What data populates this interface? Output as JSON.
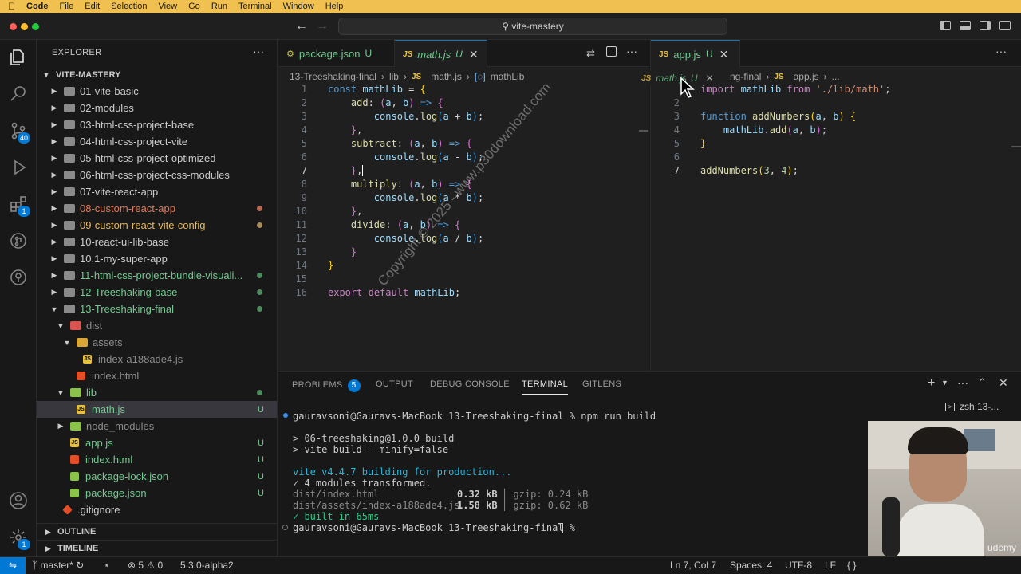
{
  "menubar": {
    "app": "Code",
    "items": [
      "File",
      "Edit",
      "Selection",
      "View",
      "Go",
      "Run",
      "Terminal",
      "Window",
      "Help"
    ]
  },
  "titlebar": {
    "search": "vite-mastery"
  },
  "activity": {
    "scm_badge": "40",
    "extensions_badge": "1",
    "settings_badge": "1"
  },
  "sidebar": {
    "title": "EXPLORER",
    "root": "VITE-MASTERY",
    "outline": "OUTLINE",
    "timeline": "TIMELINE",
    "items": [
      {
        "label": "01-vite-basic"
      },
      {
        "label": "02-modules"
      },
      {
        "label": "03-html-css-project-base"
      },
      {
        "label": "04-html-css-project-vite"
      },
      {
        "label": "05-html-css-project-optimized"
      },
      {
        "label": "06-html-css-project-css-modules"
      },
      {
        "label": "07-vite-react-app"
      },
      {
        "label": "08-custom-react-app"
      },
      {
        "label": "09-custom-react-vite-config"
      },
      {
        "label": "10-react-ui-lib-base"
      },
      {
        "label": "10.1-my-super-app"
      },
      {
        "label": "11-html-css-project-bundle-visuali..."
      },
      {
        "label": "12-Treeshaking-base"
      },
      {
        "label": "13-Treeshaking-final"
      },
      {
        "label": "dist"
      },
      {
        "label": "assets"
      },
      {
        "label": "index-a188ade4.js"
      },
      {
        "label": "index.html"
      },
      {
        "label": "lib"
      },
      {
        "label": "math.js",
        "status": "U"
      },
      {
        "label": "node_modules"
      },
      {
        "label": "app.js",
        "status": "U"
      },
      {
        "label": "index.html",
        "status": "U"
      },
      {
        "label": "package-lock.json",
        "status": "U"
      },
      {
        "label": "package.json",
        "status": "U"
      },
      {
        "label": ".gitignore"
      }
    ]
  },
  "editor1": {
    "tabs": [
      {
        "label": "package.json",
        "status": "U"
      },
      {
        "label": "math.js",
        "status": "U"
      }
    ],
    "breadcrumb": [
      "13-Treeshaking-final",
      "lib",
      "math.js",
      "mathLib"
    ],
    "lines": [
      "1",
      "2",
      "3",
      "4",
      "5",
      "6",
      "7",
      "8",
      "9",
      "10",
      "11",
      "12",
      "13",
      "14",
      "15",
      "16"
    ]
  },
  "editor2": {
    "tabs": [
      {
        "label": "app.js",
        "status": "U"
      }
    ],
    "drag_tab": {
      "label": "math.js",
      "status": "U"
    },
    "breadcrumb": [
      "ng-final",
      "app.js",
      "..."
    ],
    "lines": [
      "2",
      "3",
      "4",
      "5",
      "6",
      "7"
    ]
  },
  "panel": {
    "tabs": [
      "PROBLEMS",
      "OUTPUT",
      "DEBUG CONSOLE",
      "TERMINAL",
      "GITLENS"
    ],
    "problems_count": "5",
    "shell": "zsh 13-...",
    "terminal": [
      "gauravsoni@Gauravs-MacBook 13-Treeshaking-final % npm run build",
      "",
      "> 06-treeshaking@1.0.0 build",
      "> vite build --minify=false",
      "",
      "vite v4.4.7 building for production...",
      "✓ 4 modules transformed.",
      "dist/index.html",
      "dist/assets/index-a188ade4.js",
      "✓ built in 65ms",
      "gauravsoni@Gauravs-MacBook 13-Treeshaking-final % "
    ],
    "sizes": [
      {
        "size": "0.32 kB",
        "gzip": "│ gzip: 0.24 kB"
      },
      {
        "size": "1.58 kB",
        "gzip": "│ gzip: 0.62 kB"
      }
    ]
  },
  "statusbar": {
    "branch": "master*",
    "errors": "5",
    "warnings": "0",
    "version": "5.3.0-alpha2",
    "position": "Ln 7, Col 7",
    "spaces": "Spaces: 4",
    "encoding": "UTF-8",
    "eol": "LF"
  },
  "watermark": "Copyright © 2025 - www.p30download.com",
  "udemy": "udemy"
}
